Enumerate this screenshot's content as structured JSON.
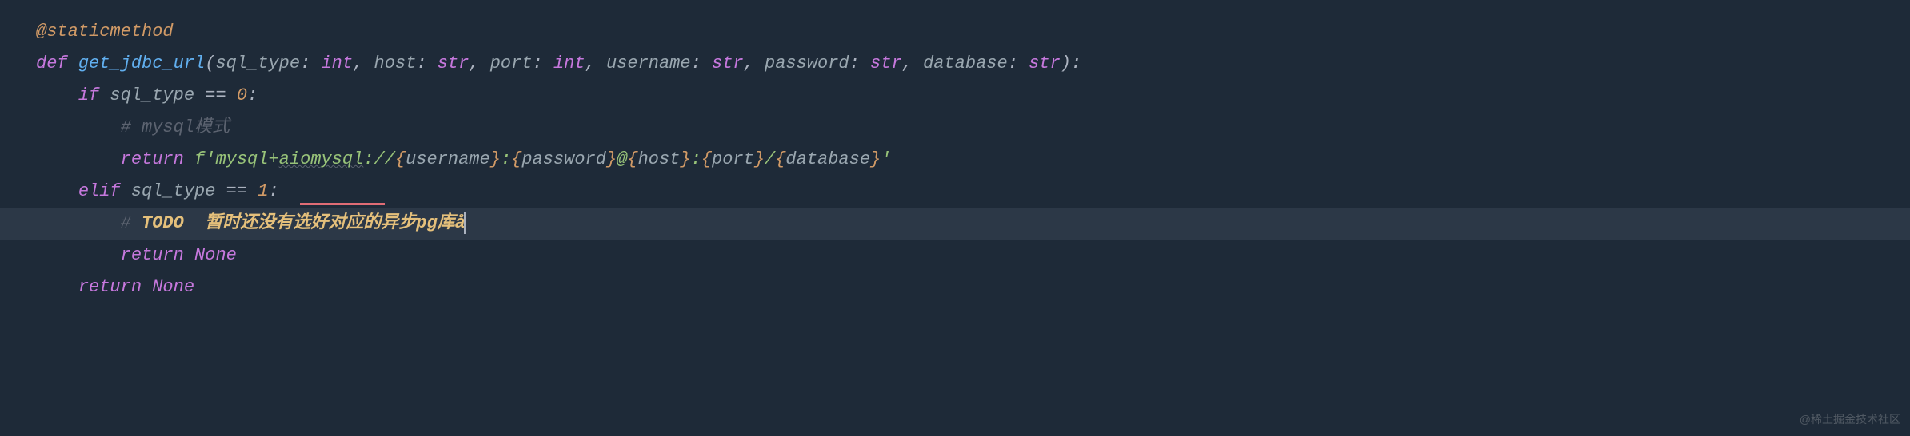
{
  "code": {
    "line1": {
      "decorator": "@staticmethod"
    },
    "line2": {
      "def": "def",
      "func": "get_jdbc_url",
      "p1": "sql_type",
      "t1": "int",
      "p2": "host",
      "t2": "str",
      "p3": "port",
      "t3": "int",
      "p4": "username",
      "t4": "str",
      "p5": "password",
      "t5": "str",
      "p6": "database",
      "t6": "str"
    },
    "line3": {
      "if": "if",
      "var": "sql_type",
      "op": "==",
      "num": "0"
    },
    "line4": {
      "comment": "# mysql模式"
    },
    "line5": {
      "return": "return",
      "fprefix": "f",
      "s1": "'mysql+",
      "s1b": "aiomysql",
      "s2": "://",
      "v1": "username",
      "s3": ":",
      "v2": "password",
      "s4": "@",
      "v3": "host",
      "s5": ":",
      "v4": "port",
      "s6": "/",
      "v5": "database",
      "s7": "'"
    },
    "line6": {
      "elif": "elif",
      "var": "sql_type",
      "op": "==",
      "num": "1"
    },
    "line7": {
      "hash": "# ",
      "todo": "TODO",
      "rest": "  暂时还没有选好对应的异步pg库å"
    },
    "line8": {
      "return": "return",
      "none": "None"
    },
    "line9": {
      "return": "return",
      "none": "None"
    }
  },
  "watermark": "@稀土掘金技术社区"
}
